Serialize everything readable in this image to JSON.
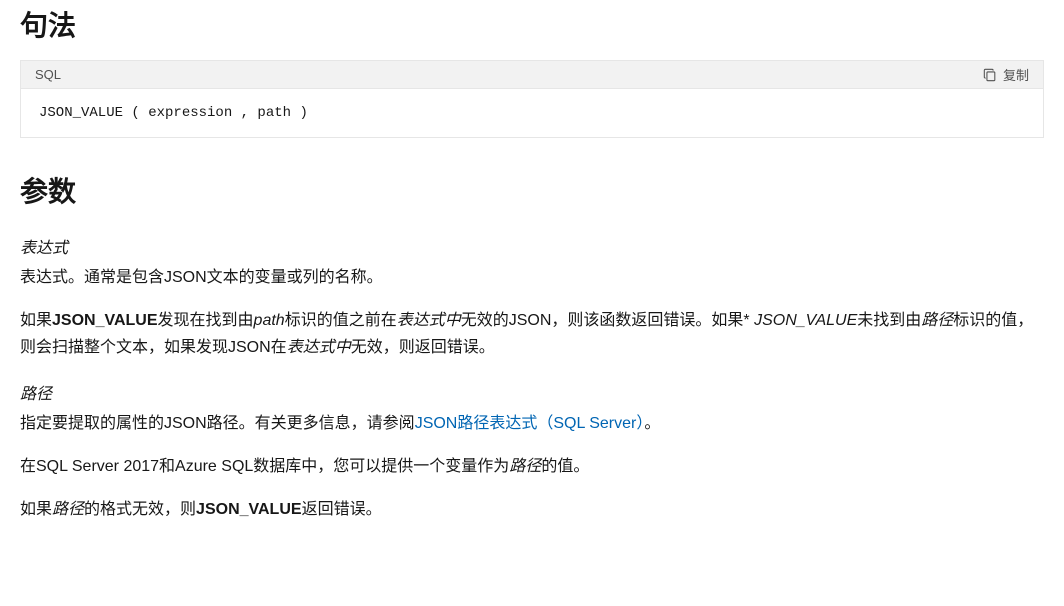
{
  "syntax": {
    "heading": "句法",
    "lang_label": "SQL",
    "copy_label": "复制",
    "code": "JSON_VALUE ( expression , path )"
  },
  "params": {
    "heading": "参数",
    "expression": {
      "name": "表达式",
      "desc": "表达式。通常是包含JSON文本的变量或列的名称。",
      "note_p1_a": "如果",
      "note_p1_b": "JSON_VALUE",
      "note_p1_c": "发现在找到由",
      "note_p1_d": "path",
      "note_p1_e": "标识的值之前在",
      "note_p1_f": "表达式中",
      "note_p1_g": "无效的JSON，则该函数返回错误。如果* ",
      "note_p1_h": "JSON_VALUE",
      "note_p1_i": "未找到由",
      "note_p1_j": "路径",
      "note_p1_k": "标识的值，则会扫描整个文本，如果发现JSON在",
      "note_p1_l": "表达式中",
      "note_p1_m": "无效，则返回错误。"
    },
    "path": {
      "name": "路径",
      "desc_a": "指定要提取的属性的JSON路径。有关更多信息，请参阅",
      "desc_link": "JSON路径表达式（SQL Server）",
      "desc_b": "。",
      "p2_a": "在SQL Server 2017和Azure SQL数据库中，您可以提供一个变量作为",
      "p2_b": "路径",
      "p2_c": "的值。",
      "p3_a": "如果",
      "p3_b": "路径",
      "p3_c": "的格式无效，则",
      "p3_d": "JSON_VALUE",
      "p3_e": "返回错误。"
    }
  }
}
